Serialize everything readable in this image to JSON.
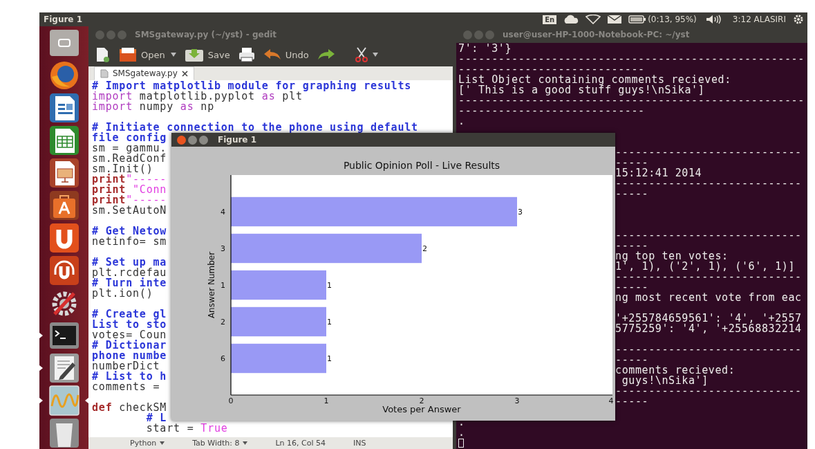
{
  "top_panel": {
    "active_app": "Figure 1",
    "keyboard": "En",
    "battery": "(0:13, 95%)",
    "clock": "3:12 ALASIRI"
  },
  "launcher": [
    {
      "kind": "dash",
      "running": false,
      "focused": false
    },
    {
      "kind": "browser",
      "running": false,
      "focused": false
    },
    {
      "kind": "writer",
      "running": false,
      "focused": false
    },
    {
      "kind": "calc",
      "running": false,
      "focused": false
    },
    {
      "kind": "impress",
      "running": false,
      "focused": false
    },
    {
      "kind": "software",
      "running": false,
      "focused": false
    },
    {
      "kind": "u",
      "running": false,
      "focused": false
    },
    {
      "kind": "u-music",
      "running": false,
      "focused": false
    },
    {
      "kind": "settings",
      "running": false,
      "focused": false
    },
    {
      "kind": "terminal",
      "running": true,
      "focused": false
    },
    {
      "kind": "editor",
      "running": true,
      "focused": false
    },
    {
      "kind": "wave",
      "running": true,
      "focused": true
    },
    {
      "kind": "trash",
      "running": false,
      "focused": false
    }
  ],
  "gedit": {
    "title": "SMSgateway.py (~/yst) - gedit",
    "toolbar": {
      "open": "Open",
      "save": "Save",
      "undo": "Undo"
    },
    "tabs": [
      {
        "label": "SMSgateway.py",
        "selected": true
      }
    ],
    "code_lines": [
      {
        "kind": "code",
        "segments": [
          {
            "kind": "comment",
            "text": "# Import matplotlib module for graphing results"
          }
        ]
      },
      {
        "kind": "code",
        "segments": [
          {
            "kind": "keyword",
            "text": "import"
          },
          {
            "kind": "plain",
            "text": " matplotlib.pyplot "
          },
          {
            "kind": "keyword",
            "text": "as"
          },
          {
            "kind": "plain",
            "text": " plt"
          }
        ]
      },
      {
        "kind": "code",
        "segments": [
          {
            "kind": "keyword",
            "text": "import"
          },
          {
            "kind": "plain",
            "text": " numpy "
          },
          {
            "kind": "keyword",
            "text": "as"
          },
          {
            "kind": "plain",
            "text": " np"
          }
        ]
      },
      {
        "kind": "blank"
      },
      {
        "kind": "code",
        "segments": [
          {
            "kind": "comment",
            "text": "# Initiate connection to the phone using default"
          }
        ]
      },
      {
        "kind": "code",
        "segments": [
          {
            "kind": "comment",
            "text": "file config"
          }
        ]
      },
      {
        "kind": "code",
        "segments": [
          {
            "kind": "plain",
            "text": "sm = gammu."
          }
        ]
      },
      {
        "kind": "code",
        "segments": [
          {
            "kind": "plain",
            "text": "sm.ReadConf"
          }
        ]
      },
      {
        "kind": "code",
        "segments": [
          {
            "kind": "plain",
            "text": "sm.Init()"
          }
        ]
      },
      {
        "kind": "code",
        "segments": [
          {
            "kind": "statement",
            "text": "print"
          },
          {
            "kind": "string",
            "text": "\"-----"
          }
        ]
      },
      {
        "kind": "code",
        "segments": [
          {
            "kind": "statement",
            "text": "print"
          },
          {
            "kind": "string",
            "text": " \"Conn"
          }
        ]
      },
      {
        "kind": "code",
        "segments": [
          {
            "kind": "statement",
            "text": "print"
          },
          {
            "kind": "string",
            "text": "\"-----"
          }
        ]
      },
      {
        "kind": "code",
        "segments": [
          {
            "kind": "plain",
            "text": "sm.SetAutoN"
          }
        ]
      },
      {
        "kind": "blank"
      },
      {
        "kind": "code",
        "segments": [
          {
            "kind": "comment",
            "text": "# Get Netow"
          }
        ]
      },
      {
        "kind": "code",
        "segments": [
          {
            "kind": "plain",
            "text": "netinfo= sm"
          }
        ]
      },
      {
        "kind": "blank"
      },
      {
        "kind": "code",
        "segments": [
          {
            "kind": "comment",
            "text": "# Set up ma"
          }
        ]
      },
      {
        "kind": "code",
        "segments": [
          {
            "kind": "plain",
            "text": "plt.rcdefau"
          }
        ]
      },
      {
        "kind": "code",
        "segments": [
          {
            "kind": "comment",
            "text": "# Turn inte"
          }
        ]
      },
      {
        "kind": "code",
        "segments": [
          {
            "kind": "plain",
            "text": "plt.ion()"
          }
        ]
      },
      {
        "kind": "blank"
      },
      {
        "kind": "code",
        "segments": [
          {
            "kind": "comment",
            "text": "# Create gl"
          }
        ]
      },
      {
        "kind": "code",
        "segments": [
          {
            "kind": "comment",
            "text": "List to sto"
          }
        ]
      },
      {
        "kind": "code",
        "segments": [
          {
            "kind": "plain",
            "text": "votes= Coun"
          }
        ]
      },
      {
        "kind": "code",
        "segments": [
          {
            "kind": "comment",
            "text": "# Dictionar"
          }
        ]
      },
      {
        "kind": "code",
        "segments": [
          {
            "kind": "comment",
            "text": "phone numbe"
          }
        ]
      },
      {
        "kind": "code",
        "segments": [
          {
            "kind": "plain",
            "text": "numberDict"
          }
        ]
      },
      {
        "kind": "code",
        "segments": [
          {
            "kind": "comment",
            "text": "# List to h"
          }
        ]
      },
      {
        "kind": "code",
        "segments": [
          {
            "kind": "plain",
            "text": "comments ="
          }
        ]
      },
      {
        "kind": "blank"
      },
      {
        "kind": "code",
        "segments": [
          {
            "kind": "statement",
            "text": "def"
          },
          {
            "kind": "plain",
            "text": " checkSM"
          }
        ]
      },
      {
        "kind": "code",
        "segments": [
          {
            "kind": "comment",
            "text": "        # L"
          }
        ]
      },
      {
        "kind": "code",
        "segments": [
          {
            "kind": "plain",
            "text": "        start = "
          },
          {
            "kind": "constant",
            "text": "True"
          }
        ]
      }
    ],
    "status_bar": {
      "language": "Python",
      "tab_width": "Tab Width: 8",
      "position": "Ln 16, Col 54",
      "mode": "INS"
    }
  },
  "terminal": {
    "title": "user@user-HP-1000-Notebook-PC: ~/yst",
    "lines": [
      {
        "kind": "full",
        "text": "7': '3'}"
      },
      {
        "kind": "full",
        "text": "----------------------------------------------------"
      },
      {
        "kind": "full",
        "text": "----------------------------"
      },
      {
        "kind": "full",
        "text": "List Object containing comments recieved:"
      },
      {
        "kind": "full",
        "text": "[' This is a good stuff guys!\\nSika']"
      },
      {
        "kind": "full",
        "text": "----------------------------------------------------"
      },
      {
        "kind": "full",
        "text": "----------------------------"
      },
      {
        "kind": "full",
        "text": "."
      },
      {
        "kind": "blank"
      },
      {
        "kind": "blank"
      },
      {
        "kind": "partial",
        "text": "----------------------------"
      },
      {
        "kind": "partial",
        "text": "-----"
      },
      {
        "kind": "partial",
        "text": "15:12:41 2014"
      },
      {
        "kind": "partial",
        "text": "----------------------------"
      },
      {
        "kind": "partial",
        "text": "-----"
      },
      {
        "kind": "blank"
      },
      {
        "kind": "blank"
      },
      {
        "kind": "blank"
      },
      {
        "kind": "partial",
        "text": "----------------------------"
      },
      {
        "kind": "partial",
        "text": "-----"
      },
      {
        "kind": "partial",
        "text": "ng top ten votes:"
      },
      {
        "kind": "partial",
        "text": "1', 1), ('2', 1), ('6', 1)]"
      },
      {
        "kind": "partial",
        "text": "----------------------------"
      },
      {
        "kind": "partial",
        "text": "-----"
      },
      {
        "kind": "partial",
        "text": "ng most recent vote from eac"
      },
      {
        "kind": "blank"
      },
      {
        "kind": "partial",
        "text": "'+255784659561': '4', '+2557"
      },
      {
        "kind": "partial",
        "text": "5775259': '4', '+25568832214"
      },
      {
        "kind": "blank"
      },
      {
        "kind": "partial",
        "text": "----------------------------"
      },
      {
        "kind": "partial",
        "text": "-----"
      },
      {
        "kind": "partial",
        "text": "comments recieved:"
      },
      {
        "kind": "partial",
        "text": " guys!\\nSika']"
      },
      {
        "kind": "partial",
        "text": "----------------------------"
      },
      {
        "kind": "partial",
        "text": "-----"
      },
      {
        "kind": "blank"
      },
      {
        "kind": "full",
        "text": "."
      },
      {
        "kind": "full",
        "text": "."
      }
    ]
  },
  "figure_window": {
    "title": "Figure 1",
    "chart_data": {
      "type": "bar",
      "orientation": "horizontal",
      "title": "Public Opinion Poll - Live Results",
      "xlabel": "Votes per Answer",
      "ylabel": "Answer Number",
      "categories": [
        "4",
        "3",
        "1",
        "2",
        "6"
      ],
      "values": [
        3,
        2,
        1,
        1,
        1
      ],
      "xlim": [
        0,
        4
      ],
      "xticks": [
        0,
        1,
        2,
        3,
        4
      ],
      "data_labels": true
    }
  }
}
